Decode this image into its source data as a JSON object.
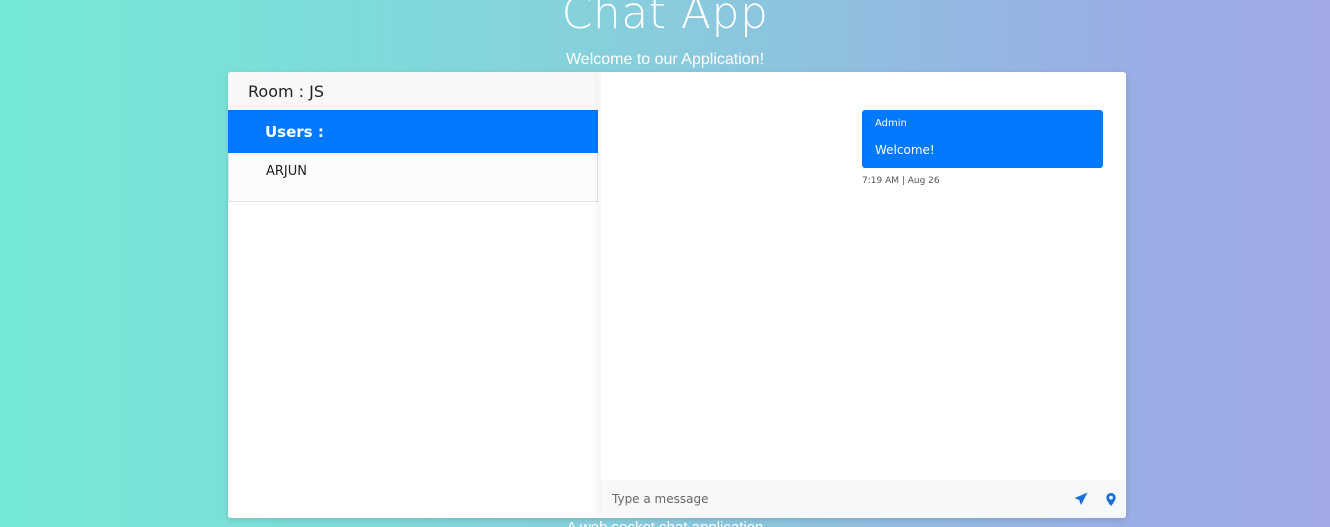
{
  "header": {
    "title": "Chat App",
    "subtitle": "Welcome to our Application!"
  },
  "footer": {
    "text": "A web socket chat application"
  },
  "room": {
    "label": "Room : JS"
  },
  "users": {
    "title": "Users :",
    "items": [
      {
        "name": "ARJUN"
      }
    ]
  },
  "messages": [
    {
      "sender": "Admin",
      "text": "Welcome!",
      "time": "7:19 AM | Aug 26"
    }
  ],
  "composer": {
    "placeholder": "Type a message",
    "send_icon": "send-icon",
    "location_icon": "location-pin-icon"
  },
  "colors": {
    "accent": "#0079ff",
    "gradient_start": "#74ead6",
    "gradient_end": "#a0a9e6"
  }
}
